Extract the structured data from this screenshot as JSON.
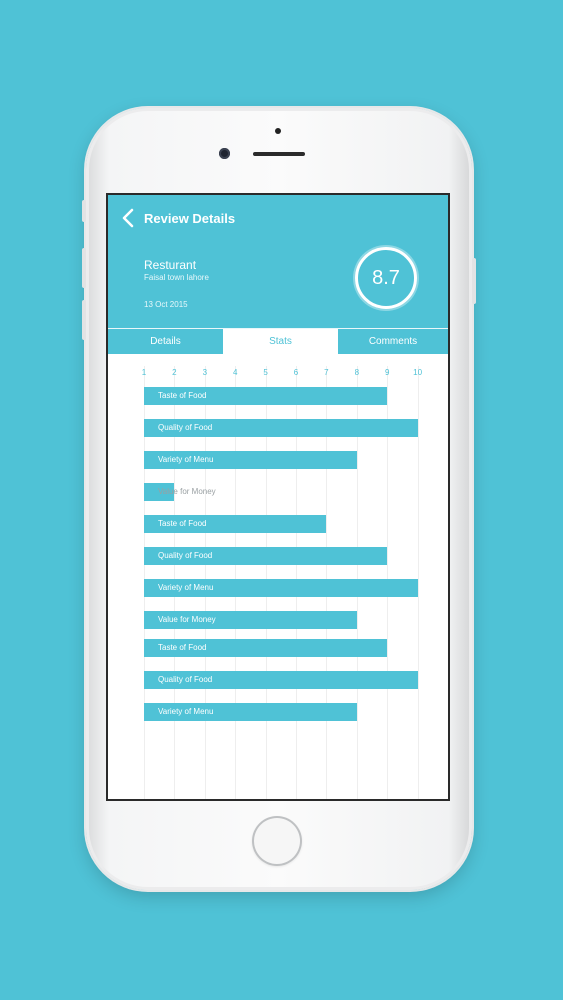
{
  "header": {
    "title": "Review Details",
    "place_name": "Resturant",
    "place_address": "Faisal town lahore",
    "date": "13 Oct 2015",
    "score": "8.7"
  },
  "tabs": [
    {
      "label": "Details",
      "active": false
    },
    {
      "label": "Stats",
      "active": true
    },
    {
      "label": "Comments",
      "active": false
    }
  ],
  "colors": {
    "accent": "#4fc2d6",
    "background": "#4fc2d6"
  },
  "chart_data": {
    "type": "bar",
    "orientation": "horizontal",
    "x_ticks": [
      "1",
      "2",
      "3",
      "4",
      "5",
      "6",
      "7",
      "8",
      "9",
      "10"
    ],
    "xlim": [
      1,
      10
    ],
    "grid": true,
    "categories": [
      "Taste of Food",
      "Quality of Food",
      "Variety of Menu",
      "Value for Money",
      "Taste of Food",
      "Quality of Food",
      "Variety of Menu",
      "Value for Money",
      "Taste of Food",
      "Quality of Food",
      "Variety of Menu"
    ],
    "values": [
      9,
      10,
      8,
      2,
      7,
      9,
      10,
      8,
      9,
      10,
      8
    ]
  }
}
